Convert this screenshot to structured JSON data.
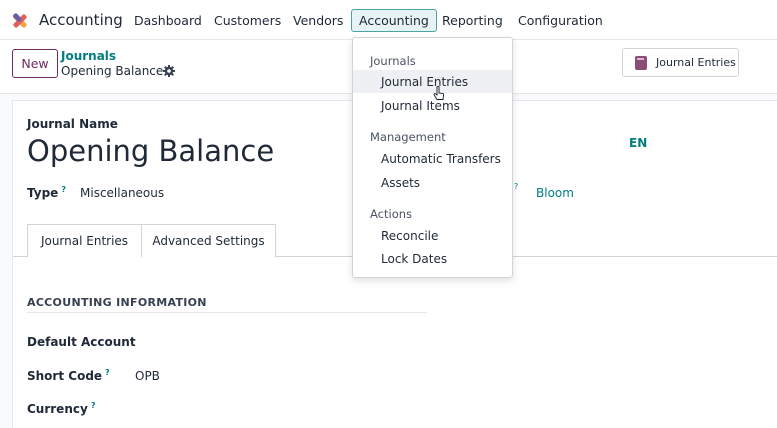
{
  "app": {
    "name": "Accounting"
  },
  "nav": {
    "items": [
      "Dashboard",
      "Customers",
      "Vendors",
      "Accounting",
      "Reporting",
      "Configuration"
    ],
    "active": "Accounting"
  },
  "control": {
    "new_label": "New",
    "breadcrumb_parent": "Journals",
    "breadcrumb_current": "Opening Balance",
    "smart_button": "Journal Entries"
  },
  "form": {
    "journal_name_label": "Journal Name",
    "journal_name": "Opening Balance",
    "language": "EN",
    "type_label": "Type",
    "type_tooltip": "?",
    "type_value": "Miscellaneous",
    "company_tooltip": "?",
    "company_value": "Bloom",
    "tabs": [
      "Journal Entries",
      "Advanced Settings"
    ],
    "section_title": "ACCOUNTING INFORMATION",
    "fields": {
      "default_account_label": "Default Account",
      "short_code_label": "Short Code",
      "short_code_tooltip": "?",
      "short_code_value": "OPB",
      "currency_label": "Currency",
      "currency_tooltip": "?"
    }
  },
  "menu": {
    "groups": [
      {
        "header": "Journals",
        "items": [
          "Journal Entries",
          "Journal Items"
        ]
      },
      {
        "header": "Management",
        "items": [
          "Automatic Transfers",
          "Assets"
        ]
      },
      {
        "header": "Actions",
        "items": [
          "Reconcile",
          "Lock Dates"
        ]
      }
    ],
    "hovered_item": "Journal Entries"
  },
  "colors": {
    "brand": "#71295f",
    "link": "#017e84",
    "active_nav_bg": "#e6f2f3"
  }
}
